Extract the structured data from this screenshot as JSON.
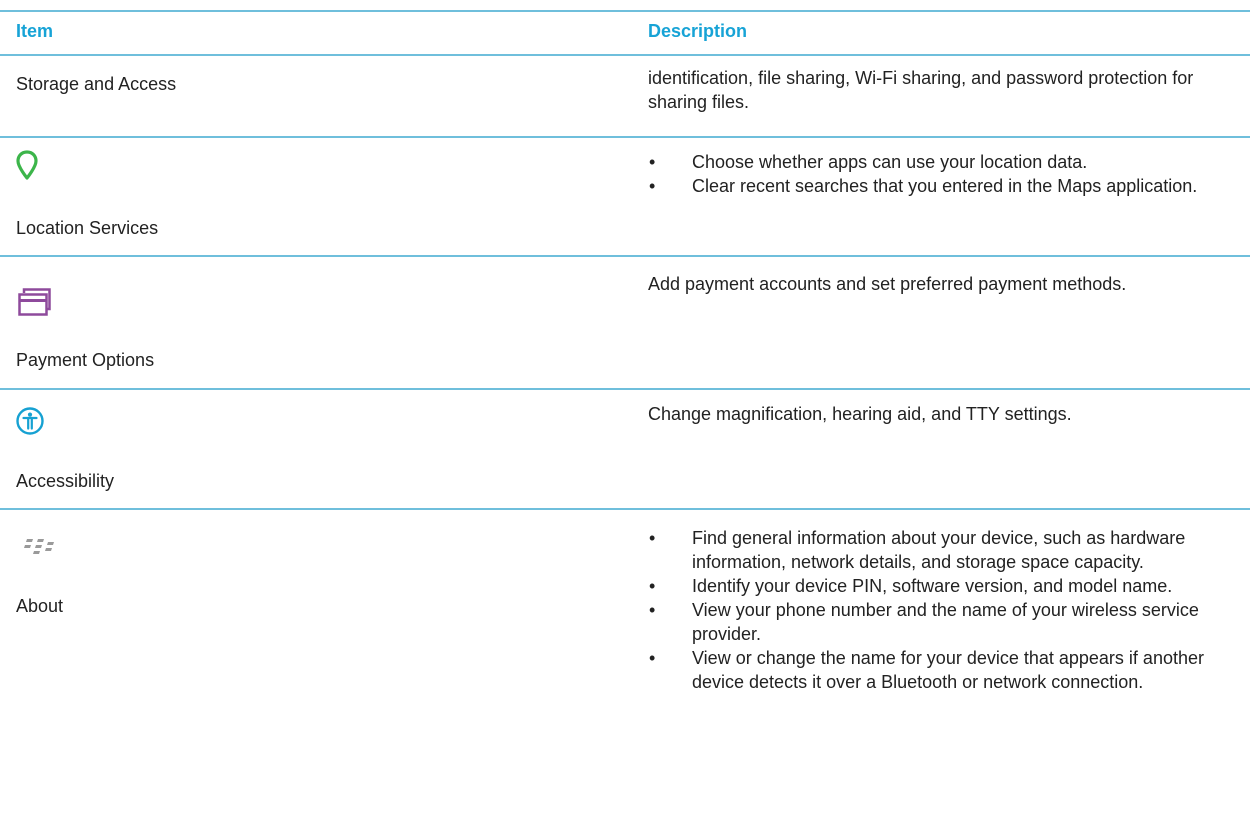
{
  "header": {
    "item_label": "Item",
    "description_label": "Description"
  },
  "colors": {
    "header_text": "#17a3d6",
    "rule": "#6fbfdc",
    "body_text": "#222222",
    "location_icon": "#3cb54a",
    "payment_icon": "#8e4a9c",
    "accessibility_icon": "#16a1d2",
    "about_icon": "#9a9a9a"
  },
  "rows": [
    {
      "item": "Storage and Access",
      "icon": "none",
      "description": "identification, file sharing, Wi-Fi sharing, and password protection for sharing files."
    },
    {
      "item": "Location Services",
      "icon": "location-pin-icon",
      "bullets": [
        "Choose whether apps can use your location data.",
        "Clear recent searches that you entered in the Maps application."
      ]
    },
    {
      "item": "Payment Options",
      "icon": "credit-card-icon",
      "description": "Add payment accounts and set preferred payment methods."
    },
    {
      "item": "Accessibility",
      "icon": "accessibility-icon",
      "description": "Change magnification, hearing aid, and TTY settings."
    },
    {
      "item": "About",
      "icon": "blackberry-logo-icon",
      "bullets": [
        "Find general information about your device, such as hardware information, network details, and storage space capacity.",
        "Identify your device PIN, software version, and model name.",
        "View your phone number and the name of your wireless service provider.",
        "View or change the name for your device that appears if another device detects it over a Bluetooth or network connection."
      ]
    }
  ],
  "bullet_glyph": "•"
}
